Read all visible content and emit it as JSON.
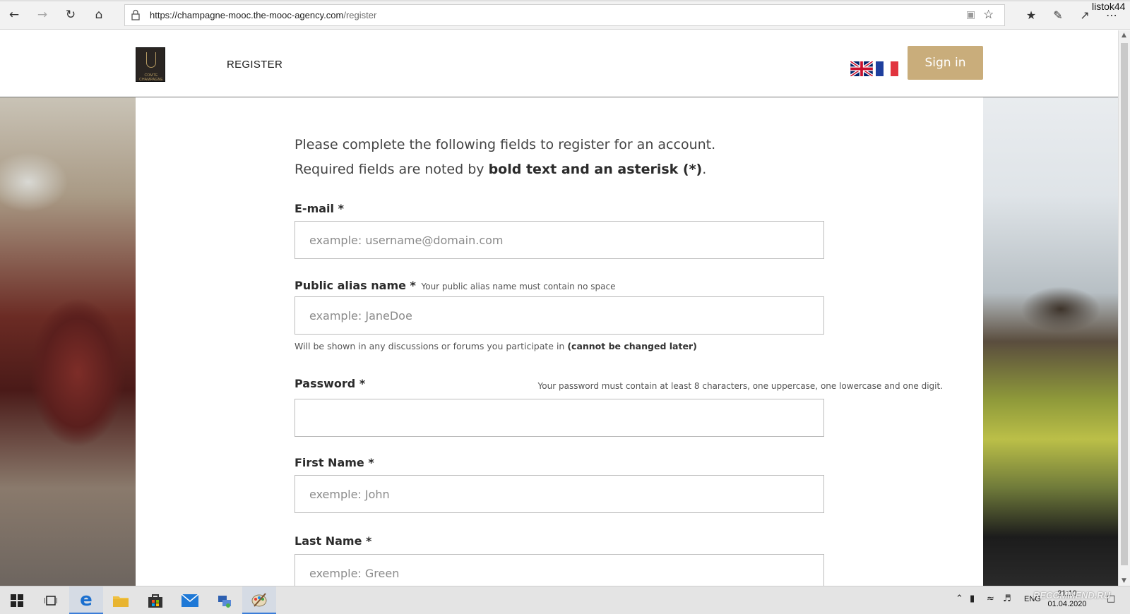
{
  "browser": {
    "url_domain": "https://champagne-mooc.the-mooc-agency.com",
    "url_path": "/register",
    "user_name": "listok44"
  },
  "header": {
    "logo_text": "COMTE CHAMPAGNE",
    "nav_register": "REGISTER",
    "signin_label": "Sign in",
    "accent_color": "#c9ad7b"
  },
  "form": {
    "intro_line1": "Please complete the following fields to register for an account.",
    "intro_line2_prefix": "Required fields are noted by ",
    "intro_line2_bold": "bold text and an asterisk (*)",
    "intro_line2_suffix": ".",
    "email": {
      "label": "E-mail *",
      "placeholder": "example: username@domain.com"
    },
    "alias": {
      "label": "Public alias name *",
      "hint": "Your public alias name must contain no space",
      "placeholder": "example: JaneDoe",
      "note_prefix": "Will be shown in any discussions or forums you participate in ",
      "note_bold": "(cannot be changed later)"
    },
    "password": {
      "label": "Password *",
      "hint": "Your password must contain at least 8 characters, one uppercase, one lowercase and one digit.",
      "placeholder": ""
    },
    "first_name": {
      "label": "First Name *",
      "placeholder": "exemple: John"
    },
    "last_name": {
      "label": "Last Name *",
      "placeholder": "exemple: Green"
    }
  },
  "taskbar": {
    "lang": "ENG",
    "time": "21:10",
    "date": "01.04.2020",
    "watermark": "RECOMMEND.RU"
  }
}
